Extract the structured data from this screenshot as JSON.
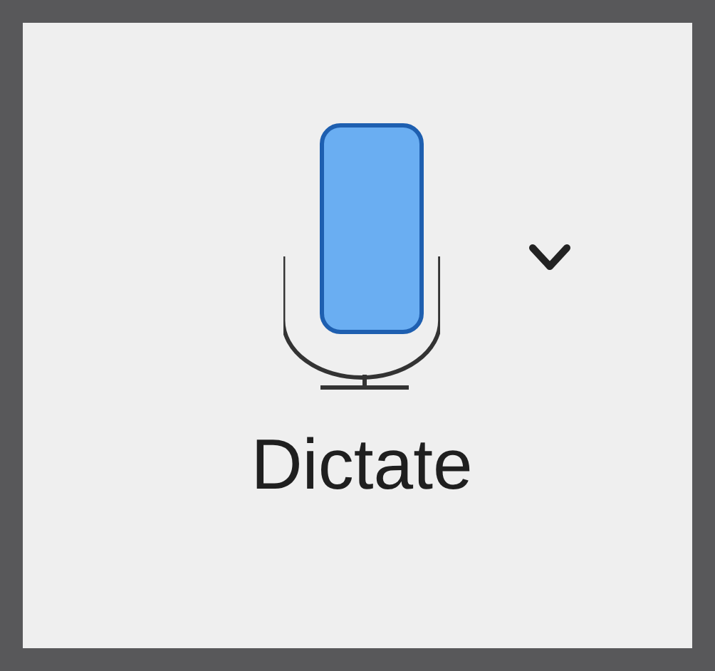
{
  "dictate_button": {
    "label": "Dictate"
  }
}
